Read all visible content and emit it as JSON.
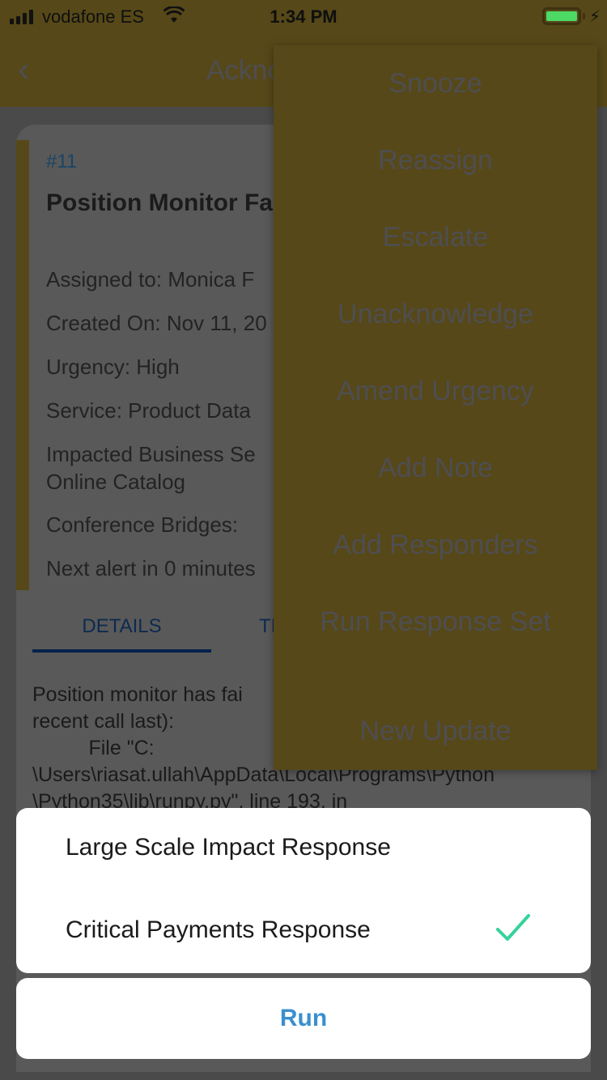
{
  "status_bar": {
    "carrier": "vodafone ES",
    "time": "1:34 PM",
    "battery_color": "#4cd964"
  },
  "nav": {
    "title": "Acknowledged",
    "back_icon": "chevron-left-icon"
  },
  "incident": {
    "number": "#11",
    "title": "Position Monitor Failed - Action Needed",
    "fields": [
      "Assigned to: Monica F",
      "Created On: Nov 11, 20",
      "Urgency: High",
      "Service: Product Data",
      "Impacted Business Se\nOnline Catalog",
      "Conference Bridges:",
      "Next alert in 0 minutes"
    ]
  },
  "tabs": [
    {
      "label": "DETAILS",
      "active": true
    },
    {
      "label": "TI",
      "active": false
    }
  ],
  "description": "Position monitor has fai\nrecent call last):\n          File \"C:\n\\Users\\riasat.ullah\\AppData\\Local\\Programs\\Python\n\\Python35\\lib\\runpy.py\", line 193, in",
  "actions_menu": {
    "items": [
      "Snooze",
      "Reassign",
      "Escalate",
      "Unacknowledge",
      "Amend Urgency",
      "Add Note",
      "Add Responders",
      "Run Response Set",
      "New Update"
    ]
  },
  "action_sheet": {
    "options": [
      {
        "label": "Large Scale Impact Response",
        "selected": false
      },
      {
        "label": "Critical Payments Response",
        "selected": true
      }
    ],
    "run_label": "Run",
    "check_color": "#34d399",
    "run_color": "#3a8fcf"
  }
}
